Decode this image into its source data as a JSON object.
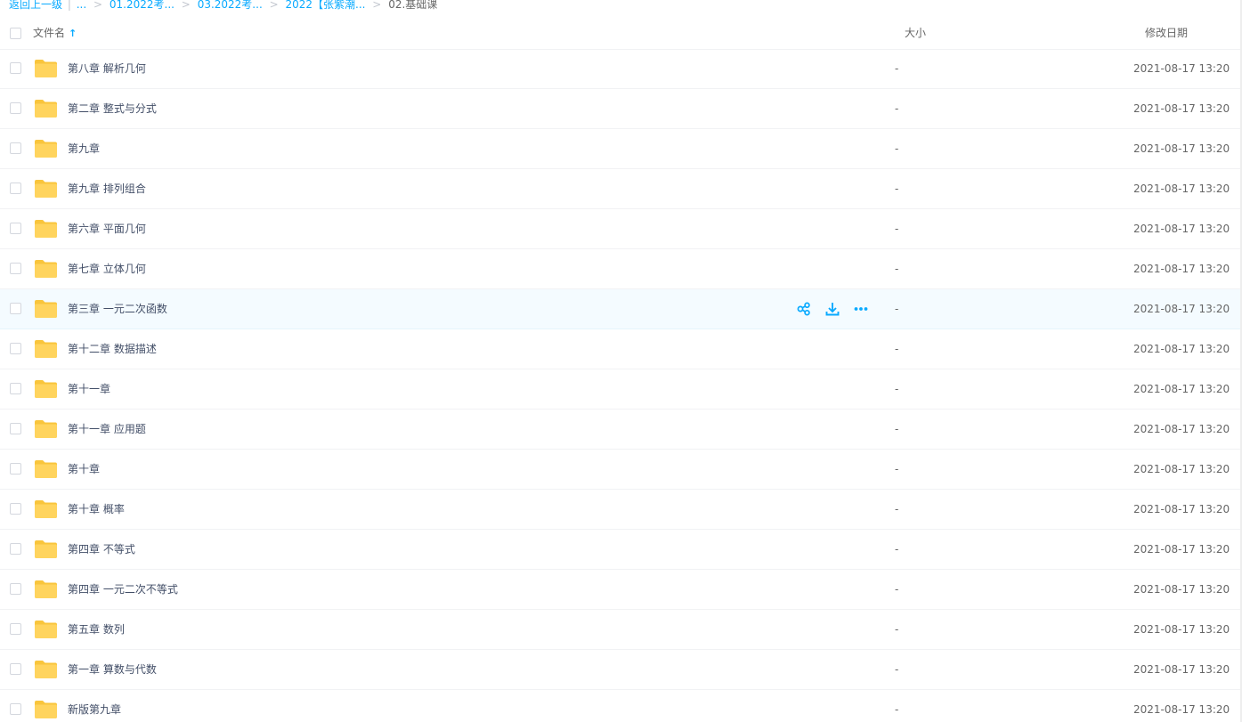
{
  "breadcrumb": {
    "back": "返回上一级",
    "pipe": "|",
    "ellipsis": "...",
    "sep": ">",
    "items": [
      "01.2022考...",
      "03.2022考...",
      "2022【张紫潮..."
    ],
    "current": "02.基础课"
  },
  "header": {
    "name": "文件名",
    "sort_arrow": "↑",
    "size": "大小",
    "date": "修改日期"
  },
  "files": [
    {
      "name": "第八章 解析几何",
      "size": "-",
      "date": "2021-08-17 13:20"
    },
    {
      "name": "第二章 整式与分式",
      "size": "-",
      "date": "2021-08-17 13:20"
    },
    {
      "name": "第九章",
      "size": "-",
      "date": "2021-08-17 13:20"
    },
    {
      "name": "第九章 排列组合",
      "size": "-",
      "date": "2021-08-17 13:20"
    },
    {
      "name": "第六章 平面几何",
      "size": "-",
      "date": "2021-08-17 13:20"
    },
    {
      "name": "第七章 立体几何",
      "size": "-",
      "date": "2021-08-17 13:20"
    },
    {
      "name": "第三章 一元二次函数",
      "size": "-",
      "date": "2021-08-17 13:20"
    },
    {
      "name": "第十二章 数据描述",
      "size": "-",
      "date": "2021-08-17 13:20"
    },
    {
      "name": "第十一章",
      "size": "-",
      "date": "2021-08-17 13:20"
    },
    {
      "name": "第十一章 应用题",
      "size": "-",
      "date": "2021-08-17 13:20"
    },
    {
      "name": "第十章",
      "size": "-",
      "date": "2021-08-17 13:20"
    },
    {
      "name": "第十章 概率",
      "size": "-",
      "date": "2021-08-17 13:20"
    },
    {
      "name": "第四章 不等式",
      "size": "-",
      "date": "2021-08-17 13:20"
    },
    {
      "name": "第四章 一元二次不等式",
      "size": "-",
      "date": "2021-08-17 13:20"
    },
    {
      "name": "第五章 数列",
      "size": "-",
      "date": "2021-08-17 13:20"
    },
    {
      "name": "第一章 算数与代数",
      "size": "-",
      "date": "2021-08-17 13:20"
    },
    {
      "name": "新版第九章",
      "size": "-",
      "date": "2021-08-17 13:20"
    }
  ],
  "hovered_index": 6,
  "row_actions": [
    "share-icon",
    "download-icon",
    "more-icon"
  ],
  "colors": {
    "accent": "#09aaff",
    "folder": "#ffd45e",
    "folder_tab": "#f9c53c",
    "hover_bg": "#f4fbff"
  }
}
